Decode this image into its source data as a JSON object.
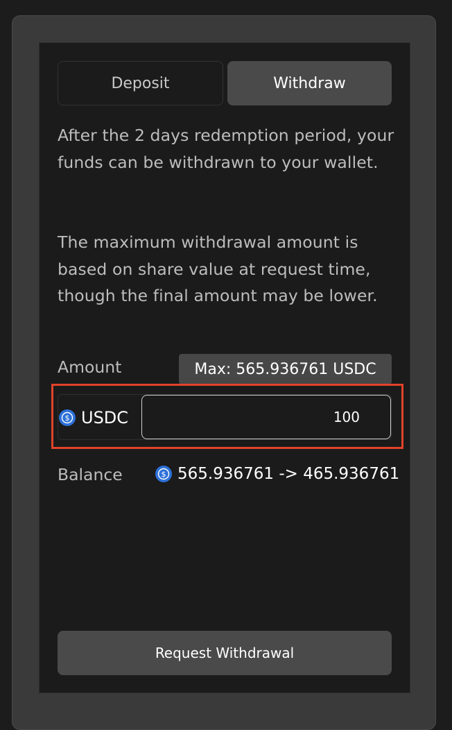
{
  "tabs": {
    "deposit_label": "Deposit",
    "withdraw_label": "Withdraw",
    "active": "Withdraw"
  },
  "info": {
    "paragraph_1": "After the 2 days redemption period, your funds can be withdrawn to your wallet.",
    "paragraph_2": "The maximum withdrawal amount is based on share value at request time, though the final amount may be lower."
  },
  "amount": {
    "label": "Amount",
    "max_label": "Max: 565.936761 USDC",
    "token": "USDC",
    "token_icon": "usdc-coin-icon",
    "value": "100"
  },
  "balance": {
    "label": "Balance",
    "value": "565.936761 -> 465.936761",
    "token_icon": "usdc-coin-icon"
  },
  "actions": {
    "request_label": "Request Withdrawal"
  },
  "colors": {
    "background": "#1c1c1c",
    "panel": "#3a3a3a",
    "card": "#1b1b1b",
    "active_tab": "#4a4a4a",
    "usdc_blue": "#2d71d8",
    "highlight": "#e2432a"
  }
}
